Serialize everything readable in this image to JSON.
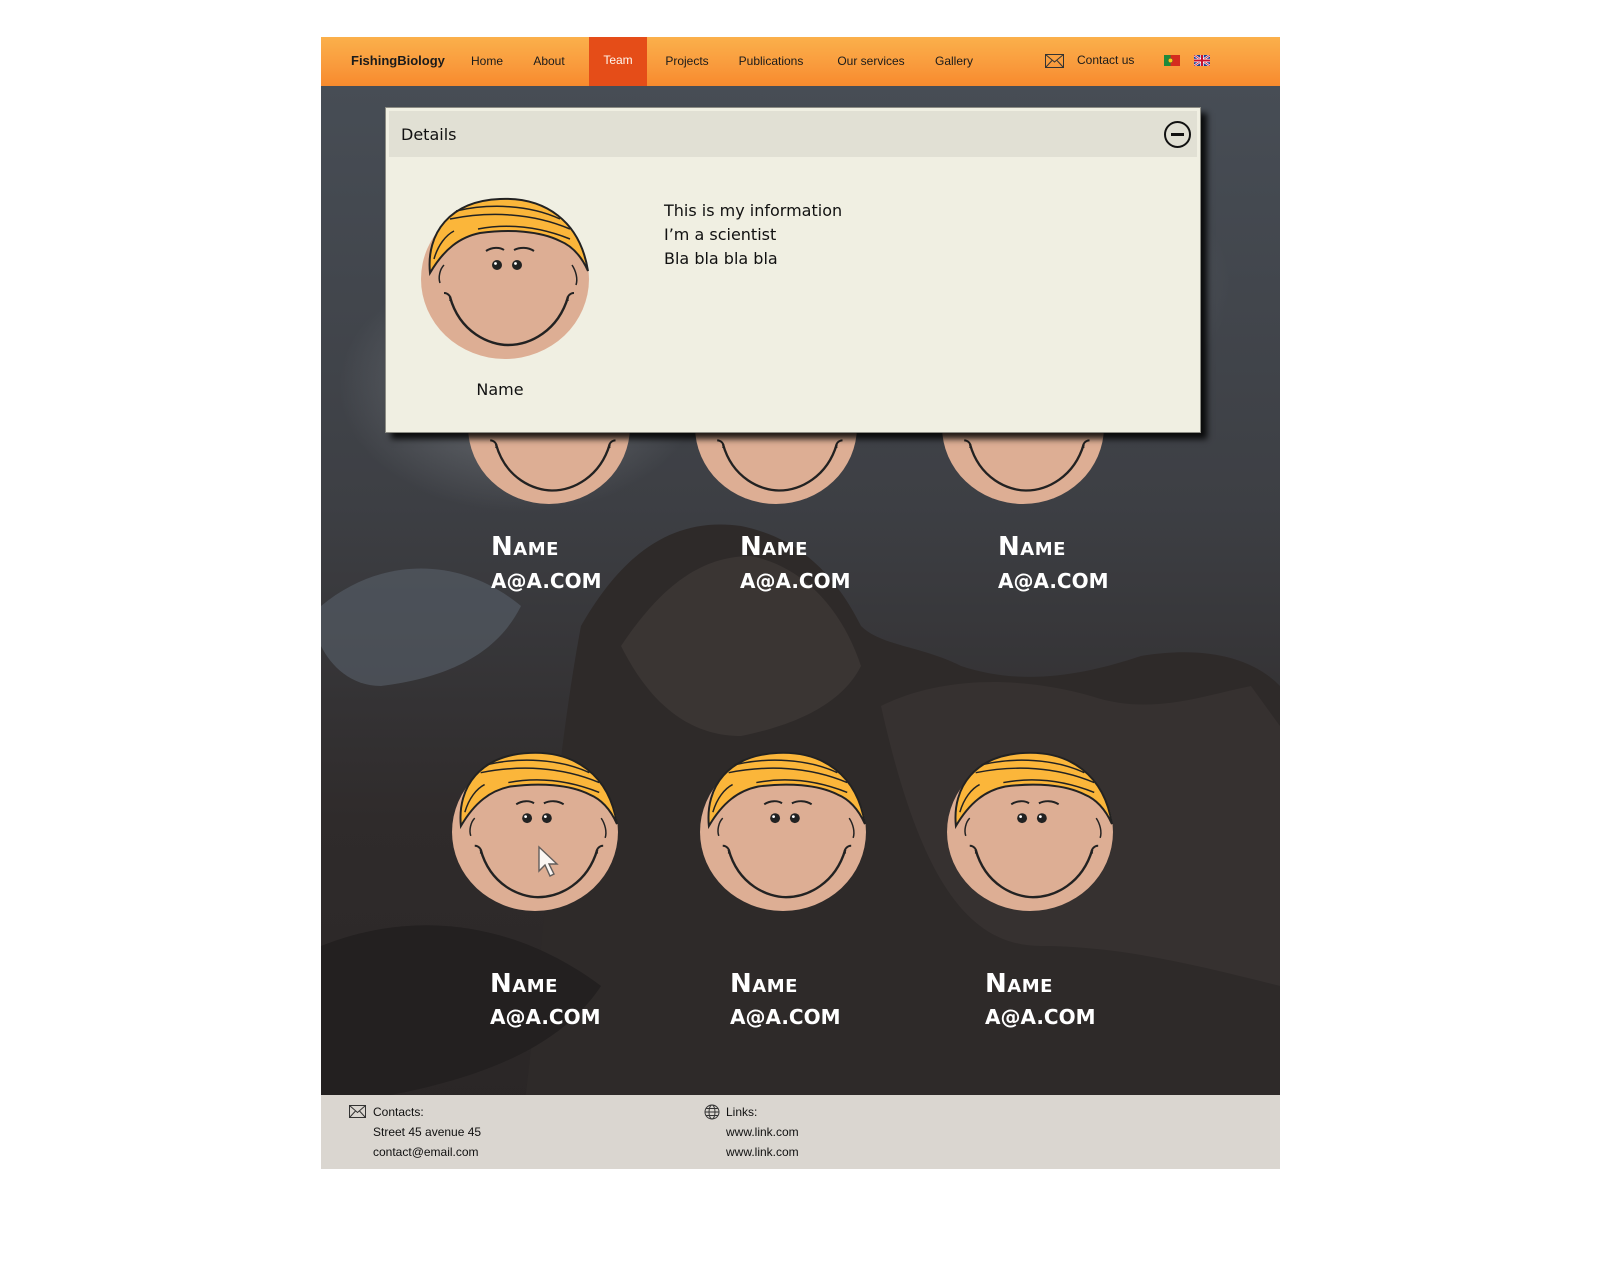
{
  "nav": {
    "brand": "FishingBiology",
    "items": [
      {
        "label": "Home"
      },
      {
        "label": "About"
      },
      {
        "label": "Team"
      },
      {
        "label": "Projects"
      },
      {
        "label": "Publications"
      },
      {
        "label": "Our services"
      },
      {
        "label": "Gallery"
      }
    ],
    "active": "Team",
    "contact_label": "Contact us"
  },
  "details": {
    "title": "Details",
    "name": "Name",
    "info": [
      "This is my information",
      "I’m a scientist",
      "Bla bla bla bla"
    ]
  },
  "team": [
    {
      "name": "Name",
      "email": "a@a.com"
    },
    {
      "name": "Name",
      "email": "a@a.com"
    },
    {
      "name": "Name",
      "email": "a@a.com"
    },
    {
      "name": "Name",
      "email": "a@a.com"
    },
    {
      "name": "Name",
      "email": "a@a.com"
    },
    {
      "name": "Name",
      "email": "a@a.com"
    }
  ],
  "footer": {
    "contacts_label": "Contacts:",
    "address": "Street 45 avenue 45",
    "email": "contact@email.com",
    "links_label": "Links:",
    "links": [
      "www.link.com",
      "www.link.com"
    ]
  },
  "colors": {
    "nav_gradient_top": "#fbb04b",
    "nav_gradient_bottom": "#f78a2d",
    "active_tab": "#e54d18",
    "panel_bg": "#f0efe2",
    "footer_bg": "#dad6d0",
    "hair": "#fbb63a",
    "skin": "#ddae94"
  }
}
